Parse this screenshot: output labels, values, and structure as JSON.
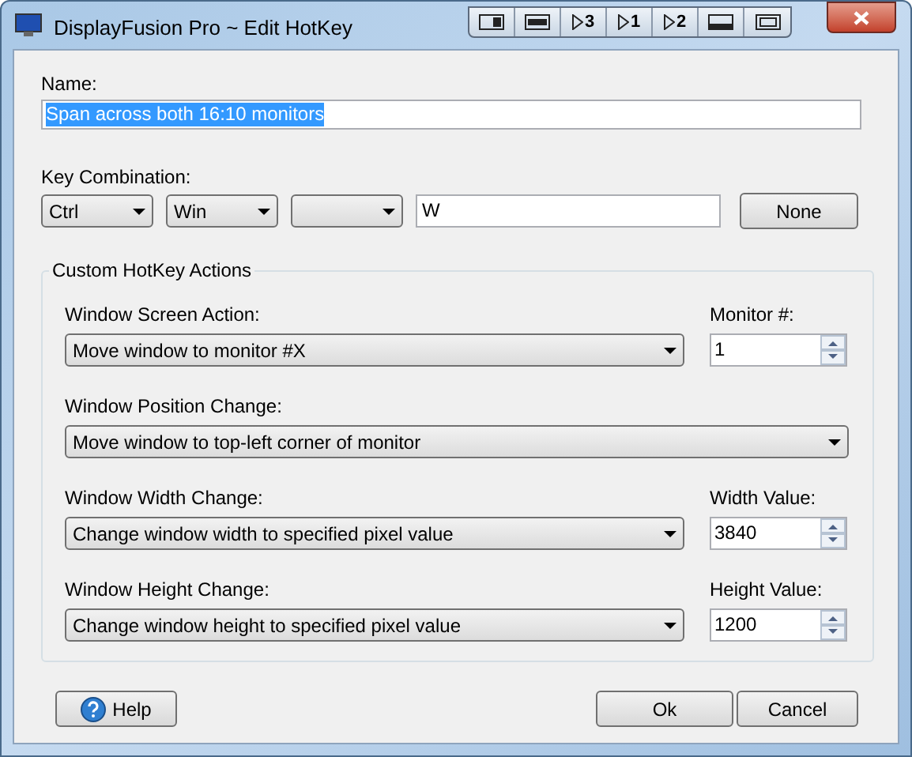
{
  "window": {
    "title": "DisplayFusion Pro ~ Edit HotKey"
  },
  "title_buttons": [
    {
      "kind": "dock"
    },
    {
      "kind": "span"
    },
    {
      "kind": "move",
      "label": "3"
    },
    {
      "kind": "move",
      "label": "1"
    },
    {
      "kind": "move",
      "label": "2"
    },
    {
      "kind": "minimize"
    },
    {
      "kind": "maximize"
    }
  ],
  "name": {
    "label": "Name:",
    "value": "Span across both 16:10 monitors",
    "selected": true
  },
  "key_combination": {
    "label": "Key Combination:",
    "modifiers": [
      {
        "kind": "dropdown",
        "value": "Ctrl"
      },
      {
        "kind": "dropdown",
        "value": "Win"
      },
      {
        "kind": "dropdown"
      }
    ],
    "key": "W",
    "button": "None"
  },
  "group": {
    "title": "Custom HotKey Actions",
    "rows": [
      {
        "label": "Window Screen Action:",
        "value": "Move window to monitor #X",
        "spin_label": "Monitor #:",
        "spin_value": "1"
      },
      {
        "label": "Window Position Change:",
        "value": "Move window to top-left corner of monitor"
      },
      {
        "label": "Window Width Change:",
        "value": "Change window width to specified pixel value",
        "spin_label": "Width Value:",
        "spin_value": "3840"
      },
      {
        "label": "Window Height Change:",
        "value": "Change window height to specified pixel value",
        "spin_label": "Height Value:",
        "spin_value": "1200"
      }
    ]
  },
  "buttons": {
    "help": "Help",
    "ok": "Ok",
    "cancel": "Cancel"
  }
}
